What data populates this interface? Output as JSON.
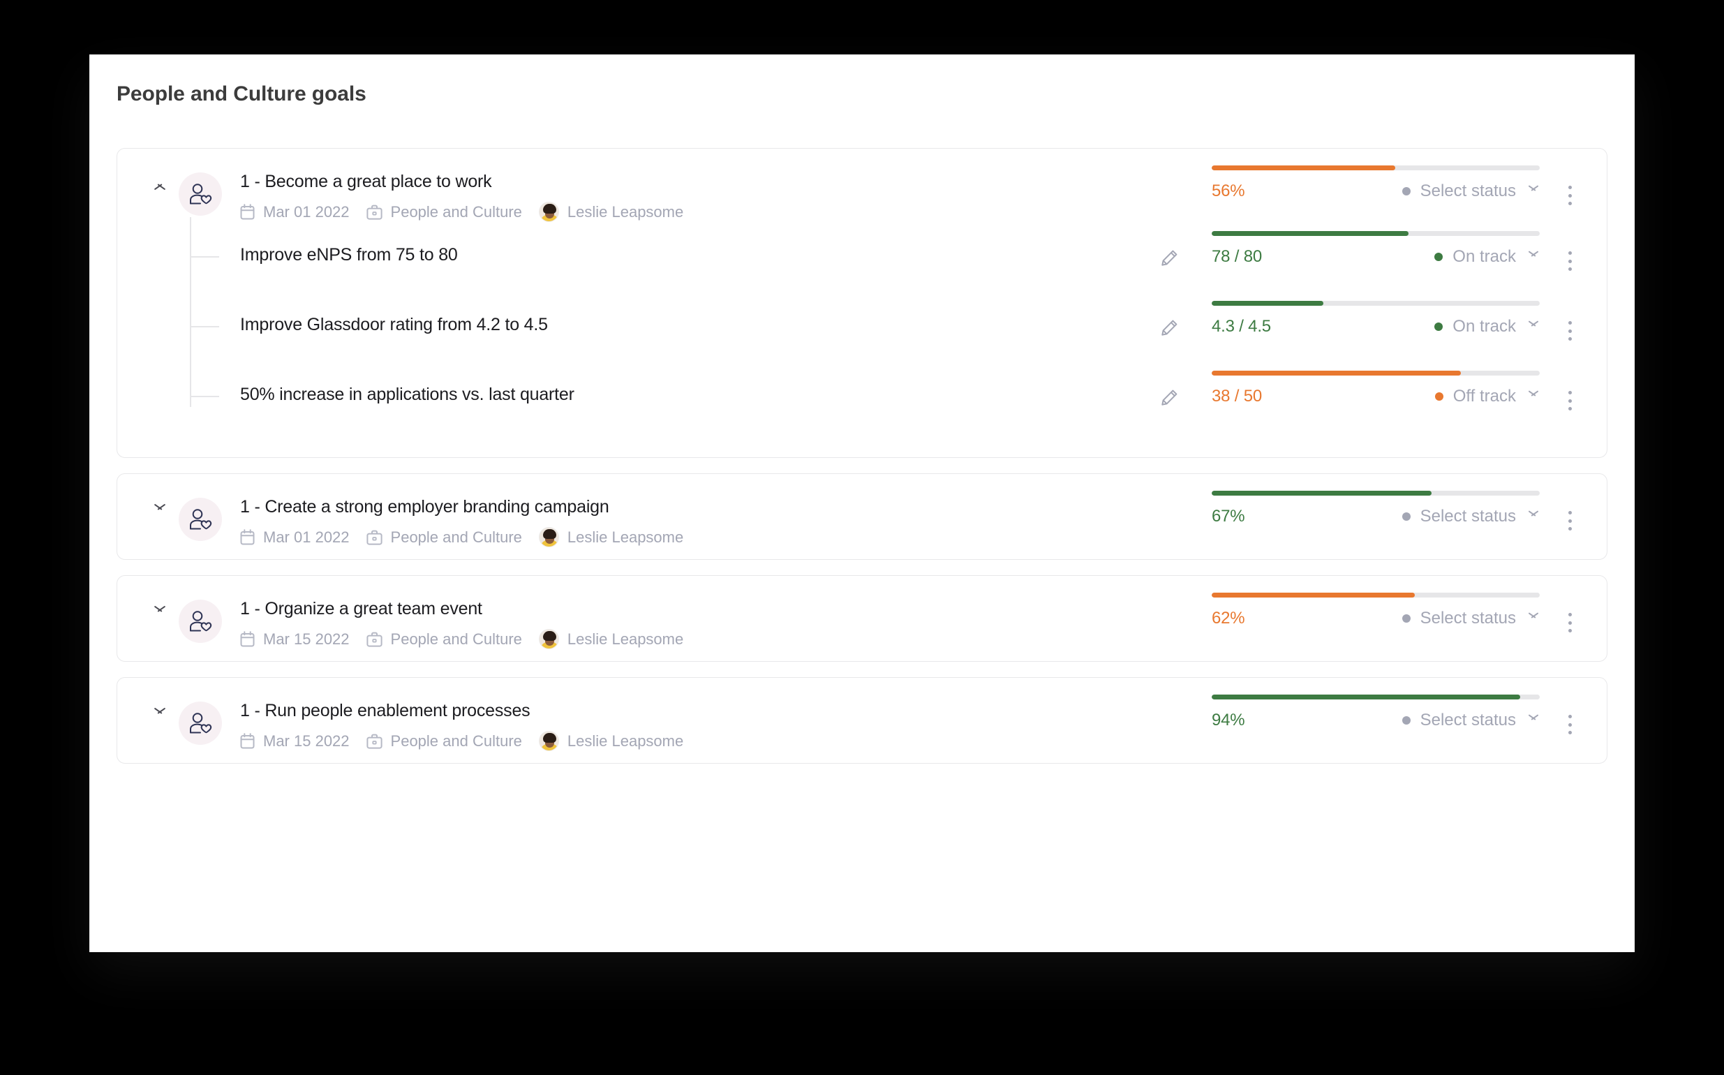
{
  "page": {
    "title": "People and Culture goals",
    "colors": {
      "orange": "#E8782F",
      "green": "#3D7B42",
      "track": "#E6E6E8",
      "muted": "#A3A6B4",
      "text": "#1C1C20",
      "status_grey": "#A3A6B4"
    },
    "background": "#000000",
    "panel": "#FFFFFF"
  },
  "goals": [
    {
      "expanded": true,
      "chevron": "chevron-up-icon",
      "icon": "person-heart-icon",
      "title": "1 - Become a great place to work",
      "date": "Mar 01 2022",
      "team": "People and Culture",
      "owner": "Leslie Leapsome",
      "progress_label": "56%",
      "progress_percent": 56,
      "progress_color": "#E8782F",
      "status_label": "Select status",
      "status_color": "#A3A6B4",
      "subgoals": [
        {
          "title": "Improve eNPS from 75 to 80",
          "value_label": "78 / 80",
          "progress_percent": 60,
          "progress_color": "#3D7B42",
          "status_label": "On track",
          "status_color": "#3D7B42"
        },
        {
          "title": "Improve Glassdoor rating from 4.2 to 4.5",
          "value_label": "4.3 / 4.5",
          "progress_percent": 34,
          "progress_color": "#3D7B42",
          "status_label": "On track",
          "status_color": "#3D7B42"
        },
        {
          "title": "50% increase in applications vs. last quarter",
          "value_label": "38 / 50",
          "progress_percent": 76,
          "progress_color": "#E8782F",
          "status_label": "Off track",
          "status_color": "#E8782F"
        }
      ]
    },
    {
      "expanded": false,
      "chevron": "chevron-down-icon",
      "icon": "person-heart-icon",
      "title": "1 - Create a strong employer branding campaign",
      "date": "Mar 01 2022",
      "team": "People and Culture",
      "owner": "Leslie Leapsome",
      "progress_label": "67%",
      "progress_percent": 67,
      "progress_color": "#3D7B42",
      "status_label": "Select status",
      "status_color": "#A3A6B4",
      "subgoals": []
    },
    {
      "expanded": false,
      "chevron": "chevron-down-icon",
      "icon": "person-heart-icon",
      "title": "1 - Organize a great team event",
      "date": "Mar 15 2022",
      "team": "People and Culture",
      "owner": "Leslie Leapsome",
      "progress_label": "62%",
      "progress_percent": 62,
      "progress_color": "#E8782F",
      "status_label": "Select status",
      "status_color": "#A3A6B4",
      "subgoals": []
    },
    {
      "expanded": false,
      "chevron": "chevron-down-icon",
      "icon": "person-heart-icon",
      "title": "1 - Run people enablement processes",
      "date": "Mar 15 2022",
      "team": "People and Culture",
      "owner": "Leslie Leapsome",
      "progress_label": "94%",
      "progress_percent": 94,
      "progress_color": "#3D7B42",
      "status_label": "Select status",
      "status_color": "#A3A6B4",
      "subgoals": []
    }
  ]
}
